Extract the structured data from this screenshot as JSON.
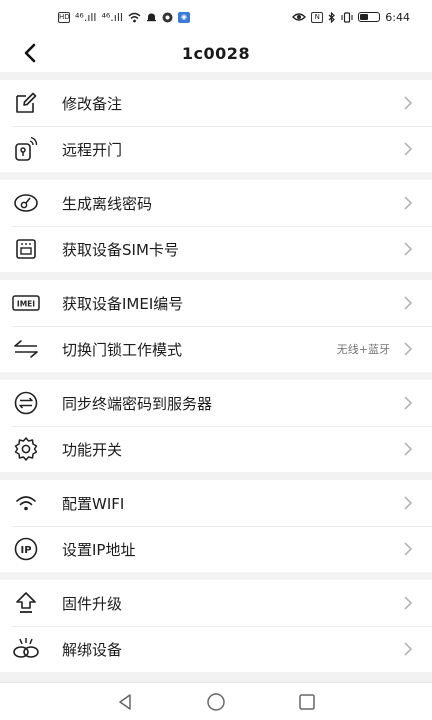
{
  "status_bar": {
    "signal_1": "⁴⁶.ıll",
    "signal_2": "⁴⁶.ıll",
    "time": "6:44"
  },
  "header": {
    "title": "1c0028"
  },
  "menu": {
    "groups": [
      {
        "items": [
          {
            "label": "修改备注",
            "icon": "edit-note-icon"
          },
          {
            "label": "远程开门",
            "icon": "remote-key-icon"
          }
        ]
      },
      {
        "items": [
          {
            "label": "生成离线密码",
            "icon": "offline-password-icon"
          },
          {
            "label": "获取设备SIM卡号",
            "icon": "sim-card-icon"
          }
        ]
      },
      {
        "items": [
          {
            "label": "获取设备IMEI编号",
            "icon": "imei-icon"
          },
          {
            "label": "切换门锁工作模式",
            "icon": "switch-mode-icon",
            "value": "无线+蓝牙"
          }
        ]
      },
      {
        "items": [
          {
            "label": "同步终端密码到服务器",
            "icon": "sync-icon"
          },
          {
            "label": "功能开关",
            "icon": "gear-icon"
          }
        ]
      },
      {
        "items": [
          {
            "label": "配置WIFI",
            "icon": "wifi-icon"
          },
          {
            "label": "设置IP地址",
            "icon": "ip-icon"
          }
        ]
      },
      {
        "items": [
          {
            "label": "固件升级",
            "icon": "upgrade-icon"
          },
          {
            "label": "解绑设备",
            "icon": "unbind-icon"
          }
        ]
      }
    ]
  },
  "colors": {
    "background": "#f2f2f2",
    "text": "#1c1c1c",
    "secondary_text": "#777777",
    "chevron": "#b5b5b5"
  }
}
